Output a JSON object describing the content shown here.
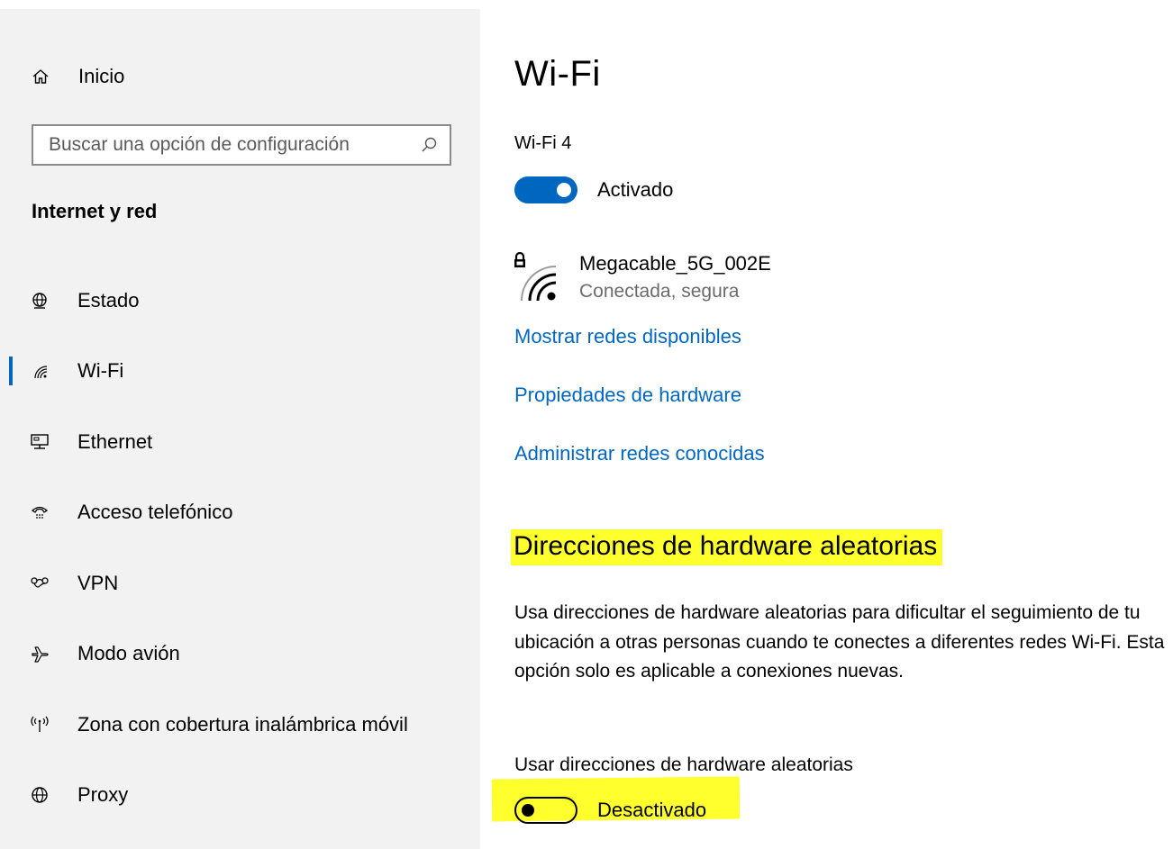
{
  "sidebar": {
    "home_label": "Inicio",
    "search_placeholder": "Buscar una opción de configuración",
    "section_title": "Internet y red",
    "items": [
      {
        "label": "Estado",
        "icon": "globe-status-icon"
      },
      {
        "label": "Wi-Fi",
        "icon": "wifi-icon",
        "selected": true
      },
      {
        "label": "Ethernet",
        "icon": "ethernet-icon"
      },
      {
        "label": "Acceso telefónico",
        "icon": "dialup-phone-icon"
      },
      {
        "label": "VPN",
        "icon": "vpn-icon"
      },
      {
        "label": "Modo avión",
        "icon": "airplane-icon"
      },
      {
        "label": "Zona con cobertura inalámbrica móvil",
        "icon": "hotspot-icon"
      },
      {
        "label": "Proxy",
        "icon": "globe-icon"
      }
    ]
  },
  "main": {
    "title": "Wi-Fi",
    "adapter_name": "Wi-Fi 4",
    "wifi_toggle": {
      "state": "on",
      "label": "Activado"
    },
    "network": {
      "name": "Megacable_5G_002E",
      "status": "Conectada, segura",
      "icon": "wifi-secured-icon"
    },
    "links": [
      "Mostrar redes disponibles",
      "Propiedades de hardware",
      "Administrar redes conocidas"
    ],
    "random_hw": {
      "heading": "Direcciones de hardware aleatorias",
      "description": "Usa direcciones de hardware aleatorias para dificultar el seguimiento de tu ubicación a otras personas cuando te conectes a diferentes redes Wi-Fi. Esta opción solo es aplicable a conexiones nuevas.",
      "option_label": "Usar direcciones de hardware aleatorias",
      "toggle": {
        "state": "off",
        "label": "Desactivado"
      }
    },
    "accent_color": "#0067c0",
    "highlight_color": "#ffff2e"
  }
}
